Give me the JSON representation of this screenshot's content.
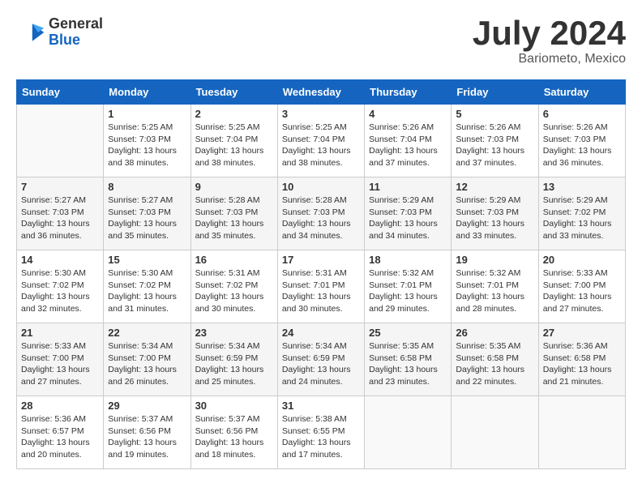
{
  "header": {
    "logo_line1": "General",
    "logo_line2": "Blue",
    "title": "July 2024",
    "location": "Bariometo, Mexico"
  },
  "weekdays": [
    "Sunday",
    "Monday",
    "Tuesday",
    "Wednesday",
    "Thursday",
    "Friday",
    "Saturday"
  ],
  "weeks": [
    [
      {
        "day": "",
        "empty": true
      },
      {
        "day": "1",
        "sunrise": "5:25 AM",
        "sunset": "7:03 PM",
        "daylight": "13 hours and 38 minutes."
      },
      {
        "day": "2",
        "sunrise": "5:25 AM",
        "sunset": "7:04 PM",
        "daylight": "13 hours and 38 minutes."
      },
      {
        "day": "3",
        "sunrise": "5:25 AM",
        "sunset": "7:04 PM",
        "daylight": "13 hours and 38 minutes."
      },
      {
        "day": "4",
        "sunrise": "5:26 AM",
        "sunset": "7:04 PM",
        "daylight": "13 hours and 37 minutes."
      },
      {
        "day": "5",
        "sunrise": "5:26 AM",
        "sunset": "7:03 PM",
        "daylight": "13 hours and 37 minutes."
      },
      {
        "day": "6",
        "sunrise": "5:26 AM",
        "sunset": "7:03 PM",
        "daylight": "13 hours and 36 minutes."
      }
    ],
    [
      {
        "day": "7",
        "sunrise": "5:27 AM",
        "sunset": "7:03 PM",
        "daylight": "13 hours and 36 minutes."
      },
      {
        "day": "8",
        "sunrise": "5:27 AM",
        "sunset": "7:03 PM",
        "daylight": "13 hours and 35 minutes."
      },
      {
        "day": "9",
        "sunrise": "5:28 AM",
        "sunset": "7:03 PM",
        "daylight": "13 hours and 35 minutes."
      },
      {
        "day": "10",
        "sunrise": "5:28 AM",
        "sunset": "7:03 PM",
        "daylight": "13 hours and 34 minutes."
      },
      {
        "day": "11",
        "sunrise": "5:29 AM",
        "sunset": "7:03 PM",
        "daylight": "13 hours and 34 minutes."
      },
      {
        "day": "12",
        "sunrise": "5:29 AM",
        "sunset": "7:03 PM",
        "daylight": "13 hours and 33 minutes."
      },
      {
        "day": "13",
        "sunrise": "5:29 AM",
        "sunset": "7:02 PM",
        "daylight": "13 hours and 33 minutes."
      }
    ],
    [
      {
        "day": "14",
        "sunrise": "5:30 AM",
        "sunset": "7:02 PM",
        "daylight": "13 hours and 32 minutes."
      },
      {
        "day": "15",
        "sunrise": "5:30 AM",
        "sunset": "7:02 PM",
        "daylight": "13 hours and 31 minutes."
      },
      {
        "day": "16",
        "sunrise": "5:31 AM",
        "sunset": "7:02 PM",
        "daylight": "13 hours and 30 minutes."
      },
      {
        "day": "17",
        "sunrise": "5:31 AM",
        "sunset": "7:01 PM",
        "daylight": "13 hours and 30 minutes."
      },
      {
        "day": "18",
        "sunrise": "5:32 AM",
        "sunset": "7:01 PM",
        "daylight": "13 hours and 29 minutes."
      },
      {
        "day": "19",
        "sunrise": "5:32 AM",
        "sunset": "7:01 PM",
        "daylight": "13 hours and 28 minutes."
      },
      {
        "day": "20",
        "sunrise": "5:33 AM",
        "sunset": "7:00 PM",
        "daylight": "13 hours and 27 minutes."
      }
    ],
    [
      {
        "day": "21",
        "sunrise": "5:33 AM",
        "sunset": "7:00 PM",
        "daylight": "13 hours and 27 minutes."
      },
      {
        "day": "22",
        "sunrise": "5:34 AM",
        "sunset": "7:00 PM",
        "daylight": "13 hours and 26 minutes."
      },
      {
        "day": "23",
        "sunrise": "5:34 AM",
        "sunset": "6:59 PM",
        "daylight": "13 hours and 25 minutes."
      },
      {
        "day": "24",
        "sunrise": "5:34 AM",
        "sunset": "6:59 PM",
        "daylight": "13 hours and 24 minutes."
      },
      {
        "day": "25",
        "sunrise": "5:35 AM",
        "sunset": "6:58 PM",
        "daylight": "13 hours and 23 minutes."
      },
      {
        "day": "26",
        "sunrise": "5:35 AM",
        "sunset": "6:58 PM",
        "daylight": "13 hours and 22 minutes."
      },
      {
        "day": "27",
        "sunrise": "5:36 AM",
        "sunset": "6:58 PM",
        "daylight": "13 hours and 21 minutes."
      }
    ],
    [
      {
        "day": "28",
        "sunrise": "5:36 AM",
        "sunset": "6:57 PM",
        "daylight": "13 hours and 20 minutes."
      },
      {
        "day": "29",
        "sunrise": "5:37 AM",
        "sunset": "6:56 PM",
        "daylight": "13 hours and 19 minutes."
      },
      {
        "day": "30",
        "sunrise": "5:37 AM",
        "sunset": "6:56 PM",
        "daylight": "13 hours and 18 minutes."
      },
      {
        "day": "31",
        "sunrise": "5:38 AM",
        "sunset": "6:55 PM",
        "daylight": "13 hours and 17 minutes."
      },
      {
        "day": "",
        "empty": true
      },
      {
        "day": "",
        "empty": true
      },
      {
        "day": "",
        "empty": true
      }
    ]
  ],
  "labels": {
    "sunrise": "Sunrise:",
    "sunset": "Sunset:",
    "daylight": "Daylight:"
  }
}
